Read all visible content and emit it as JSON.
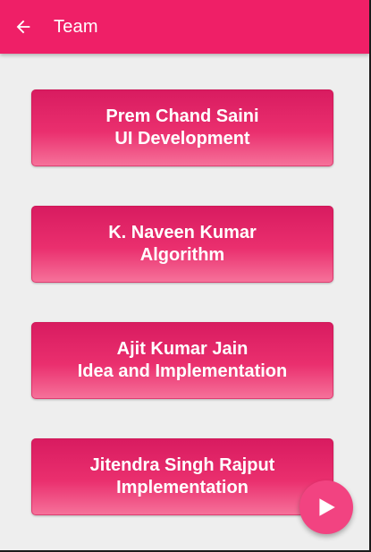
{
  "appbar": {
    "title": "Team",
    "back_icon": "arrow-back-icon"
  },
  "members": [
    {
      "name": "Prem Chand Saini",
      "role": "UI Development"
    },
    {
      "name": "K. Naveen Kumar",
      "role": "Algorithm"
    },
    {
      "name": "Ajit Kumar Jain",
      "role": "Idea and Implementation"
    },
    {
      "name": "Jitendra Singh Rajput",
      "role": "Implementation"
    }
  ],
  "fab": {
    "icon": "play-icon"
  },
  "colors": {
    "primary": "#ef1f67",
    "card_top": "#d81b60",
    "card_bottom": "#f6739b",
    "fab": "#f24381",
    "background": "#eeeeee"
  }
}
